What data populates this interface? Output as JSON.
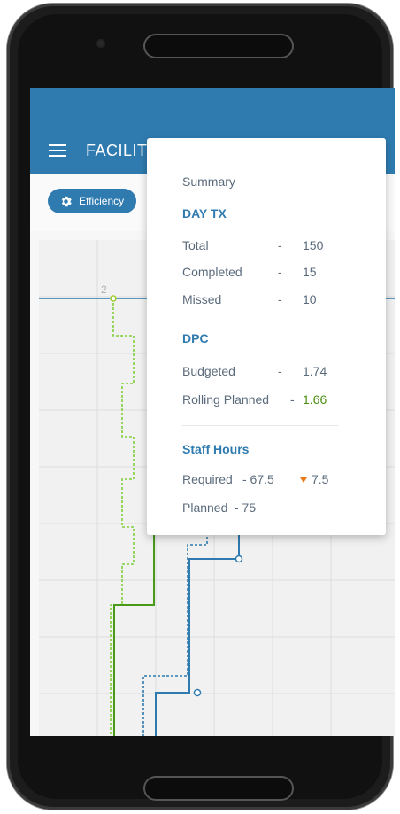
{
  "app": {
    "title": "FACILIT",
    "chip_label": "Efficiency",
    "accent_color": "#2f7bb0"
  },
  "chart": {
    "marker_label": "2",
    "colors": {
      "blue": "#2f7bb0",
      "green": "#4a9a1a",
      "green_dotted": "#7fcf3a"
    }
  },
  "summary": {
    "header": "Summary",
    "day_tx": {
      "title": "DAY TX",
      "rows": [
        {
          "label": "Total",
          "sep": "-",
          "value": "150"
        },
        {
          "label": "Completed",
          "sep": "-",
          "value": "15"
        },
        {
          "label": "Missed",
          "sep": "-",
          "value": "10"
        }
      ]
    },
    "dpc": {
      "title": "DPC",
      "rows": [
        {
          "label": "Budgeted",
          "sep": "-",
          "value": "1.74"
        },
        {
          "label": "Rolling Planned",
          "sep": "-",
          "value": "1.66"
        }
      ]
    },
    "staff_hours": {
      "title": "Staff Hours",
      "required_label": "Required",
      "required_value": "- 67.5",
      "required_delta": "7.5",
      "planned_label": "Planned",
      "planned_value": "- 75"
    }
  }
}
